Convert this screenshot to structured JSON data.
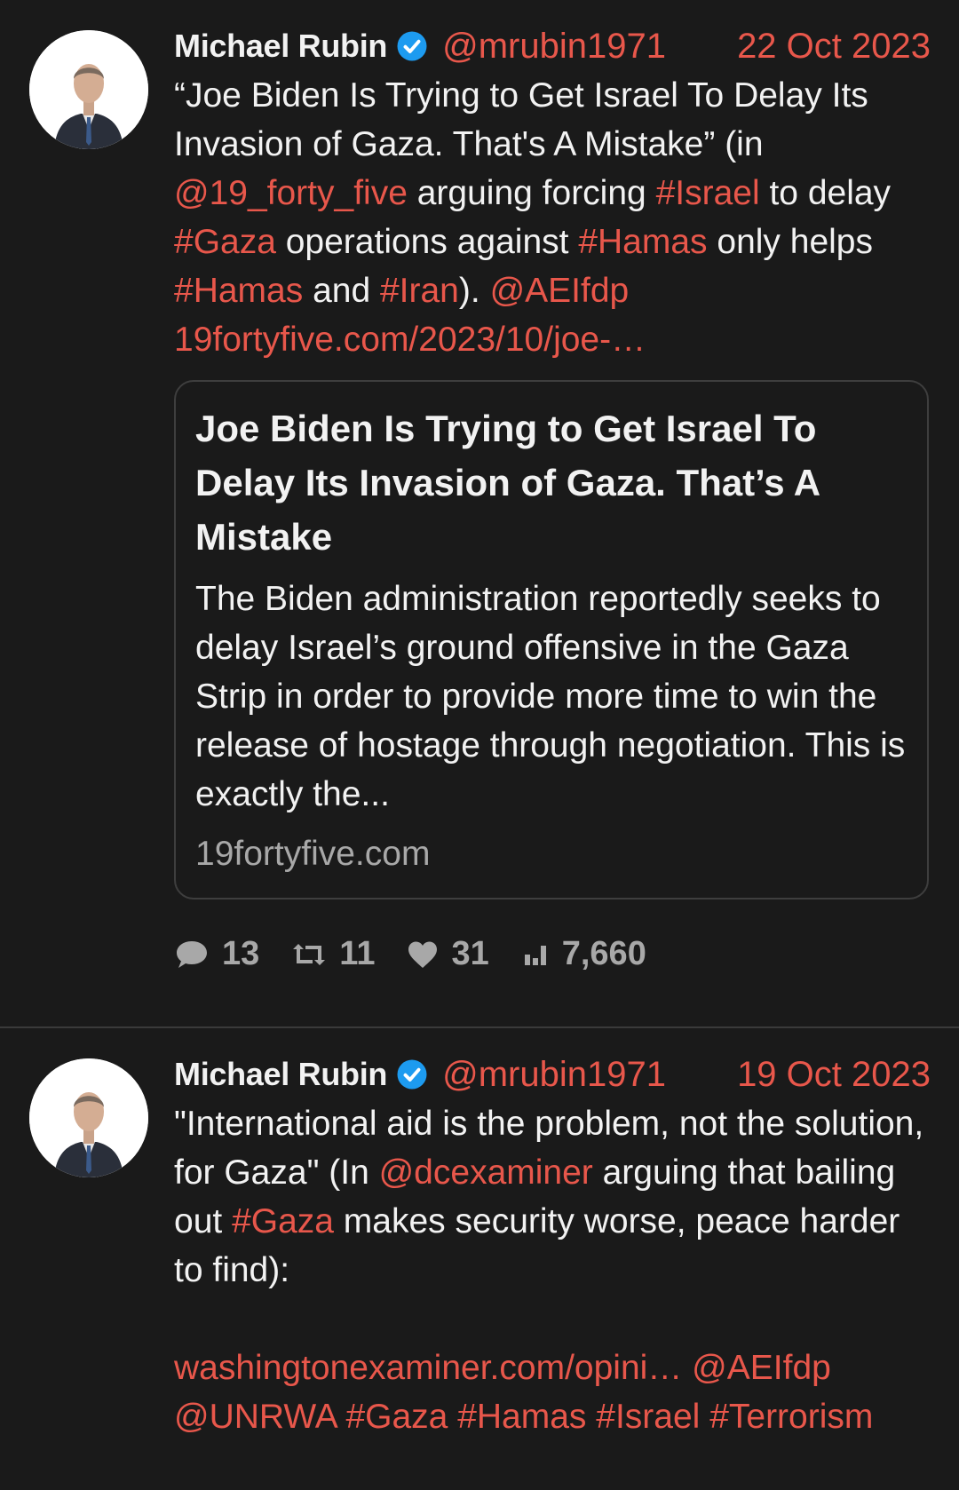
{
  "tweets": [
    {
      "author_name": "Michael Rubin",
      "handle": "@mrubin1971",
      "date": "22 Oct 2023",
      "text": [
        {
          "t": "“Joe Biden Is Trying to Get Israel To Delay Its Invasion of Gaza. That's A Mistake” (in ",
          "link": false
        },
        {
          "t": "@19_forty_five",
          "link": true
        },
        {
          "t": " arguing forcing ",
          "link": false
        },
        {
          "t": "#Israel",
          "link": true
        },
        {
          "t": " to delay ",
          "link": false
        },
        {
          "t": "#Gaza",
          "link": true
        },
        {
          "t": " operations against ",
          "link": false
        },
        {
          "t": "#Hamas",
          "link": true
        },
        {
          "t": " only helps ",
          "link": false
        },
        {
          "t": "#Hamas",
          "link": true
        },
        {
          "t": " and ",
          "link": false
        },
        {
          "t": "#Iran",
          "link": true
        },
        {
          "t": "). ",
          "link": false
        },
        {
          "t": "@AEIfdp",
          "link": true
        },
        {
          "t": " ",
          "link": false
        },
        {
          "t": "19fortyfive.com/2023/10/joe-…",
          "link": true
        }
      ],
      "card": {
        "title": "Joe Biden Is Trying to Get Israel To Delay Its Invasion of Gaza. That’s A Mistake",
        "description": "The Biden administration reportedly seeks to delay Israel’s ground offensive in the Gaza Strip in order to provide more time to win the release of hostage through negotiation. This is exactly the...",
        "domain": "19fortyfive.com"
      },
      "stats": {
        "replies": "13",
        "retweets": "11",
        "likes": "31",
        "views": "7,660"
      }
    },
    {
      "author_name": "Michael Rubin",
      "handle": "@mrubin1971",
      "date": "19 Oct 2023",
      "text": [
        {
          "t": "\"International aid is the problem, not the solution, for Gaza\" (In ",
          "link": false
        },
        {
          "t": "@dcexaminer",
          "link": true
        },
        {
          "t": " arguing that bailing out ",
          "link": false
        },
        {
          "t": "#Gaza",
          "link": true
        },
        {
          "t": " makes security worse, peace harder to find):",
          "link": false
        }
      ],
      "text2": [
        {
          "t": " ",
          "link": false
        },
        {
          "t": "washingtonexaminer.com/opini…",
          "link": true
        },
        {
          "t": " ",
          "link": false
        },
        {
          "t": "@AEIfdp",
          "link": true
        },
        {
          "t": " ",
          "link": false
        },
        {
          "t": "@UNRWA",
          "link": true
        },
        {
          "t": " ",
          "link": false
        },
        {
          "t": "#Gaza",
          "link": true
        },
        {
          "t": " ",
          "link": false
        },
        {
          "t": "#Hamas",
          "link": true
        },
        {
          "t": " ",
          "link": false
        },
        {
          "t": "#Israel",
          "link": true
        },
        {
          "t": " ",
          "link": false
        },
        {
          "t": "#Terrorism",
          "link": true
        }
      ]
    }
  ],
  "colors": {
    "background": "#1a1a1a",
    "link": "#e8574b",
    "verified": "#1d9bf0",
    "muted": "#a8a8a8"
  },
  "icons": [
    "verified-badge-icon",
    "reply-icon",
    "retweet-icon",
    "like-icon",
    "views-icon"
  ]
}
